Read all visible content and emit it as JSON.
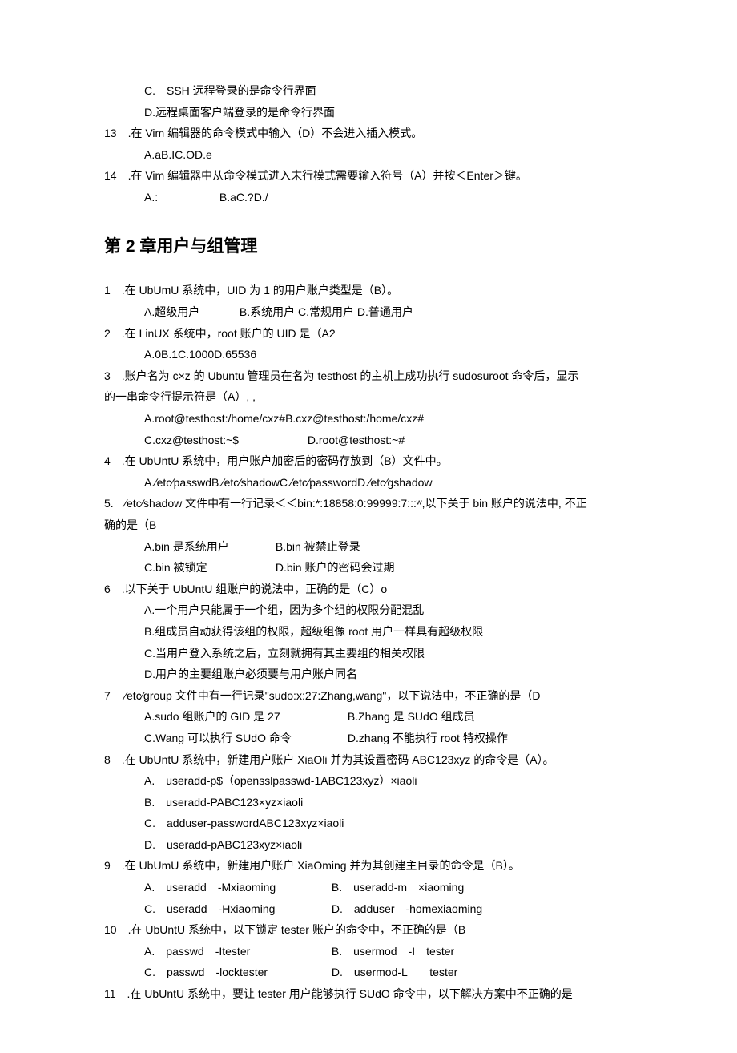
{
  "pre": {
    "optC": "C.　SSH 远程登录的是命令行界面",
    "optD": "D.远程桌面客户端登录的是命令行界面",
    "q13": "13　.在 Vim 编辑器的命令模式中输入（D）不会进入插入模式。",
    "q13opts": "A.aB.IC.OD.e",
    "q14": "14　.在 Vim 编辑器中从命令模式进入末行模式需要输入符号（A）并按＜Enter＞键。",
    "q14a": "A.:",
    "q14b": "B.aC.?D./"
  },
  "ch2title": "第 2 章用户与组管理",
  "q1": {
    "stem": "1　.在 UbUmU 系统中，UID 为 1 的用户账户类型是（B）。",
    "a": "A.超级用户",
    "b": "B.系统用户 C.常规用户 D.普通用户"
  },
  "q2": {
    "stem": "2　.在 LinUX 系统中，root 账户的 UID 是（A2",
    "opts": "A.0B.1C.1000D.65536"
  },
  "q3": {
    "stem": "3　.账户名为 c×z 的 Ubuntu 管理员在名为 testhost 的主机上成功执行 sudosuroot 命令后，显示",
    "stem2": "的一串命令行提示符是（A）, ,",
    "a": "A.root@testhost:/home/cxz#B.cxz@testhost:/home/cxz#",
    "c": "C.cxz@testhost:~$",
    "d": "D.root@testhost:~#"
  },
  "q4": {
    "stem": "4　.在 UbUntU 系统中，用户账户加密后的密码存放到（B）文件中。",
    "opts": "A.∕etc∕passwdB.∕etc∕shadowC.∕etc∕passwordD.∕etc∕gshadow"
  },
  "q5": {
    "stem": "5.　∕etc∕shadow 文件中有一行记录＜＜bin:*:18858:0:99999:7:::ʷ,以下关于 bin 账户的说法中, 不正",
    "stem2": "确的是（B",
    "a": "A.bin 是系统用户",
    "b": "B.bin 被禁止登录",
    "c": "C.bin 被锁定",
    "d": "D.bin 账户的密码会过期"
  },
  "q6": {
    "stem": "6　.以下关于 UbUntU 组账户的说法中，正确的是（C）o",
    "a": "A.一个用户只能属于一个组，因为多个组的权限分配混乱",
    "b": "B.组成员自动获得该组的权限，超级组像 root 用户一样具有超级权限",
    "c": "C.当用户登入系统之后，立刻就拥有其主要组的相关权限",
    "d": "D.用户的主要组账户必须要与用户账户同名"
  },
  "q7": {
    "stem": "7　.∕etc∕group 文件中有一行记录\"sudo:x:27:Zhang,wang\"，以下说法中，不正确的是（D",
    "a": "A.sudo 组账户的 GID 是 27",
    "b": "B.Zhang 是 SUdO 组成员",
    "c": "C.Wang 可以执行 SUdO 命令",
    "d": "D.zhang 不能执行 root 特权操作"
  },
  "q8": {
    "stem": "8　.在 UbUntU 系统中，新建用户账户 XiaOli 并为其设置密码 ABC123xyz 的命令是（A）。",
    "a": "A.　useradd-p$（opensslpasswd-1ABC123xyz）×iaoli",
    "b": "B.　useradd-PABC123×yz×iaoli",
    "c": "C.　adduser-passwordABC123xyz×iaoli",
    "d": "D.　useradd-pABC123xyz×iaoli"
  },
  "q9": {
    "stem": "9　.在 UbUmU 系统中，新建用户账户 XiaOming 并为其创建主目录的命令是（B）。",
    "a": "A.　useradd　-Mxiaoming",
    "b": "B.　useradd-m　×iaoming",
    "c": "C.　useradd　-Hxiaoming",
    "d": "D.　adduser　-homexiaoming"
  },
  "q10": {
    "stem": "10　.在 UbUntU 系统中，以下锁定 tester 账户的命令中，不正确的是（B",
    "a": "A.　passwd　-Itester",
    "b": "B.　usermod　-I　tester",
    "c": "C.　passwd　-locktester",
    "d": "D.　usermod-L　　tester"
  },
  "q11": {
    "stem": "11　.在 UbUntU 系统中，要让 tester 用户能够执行 SUdO 命令中，以下解决方案中不正确的是"
  }
}
